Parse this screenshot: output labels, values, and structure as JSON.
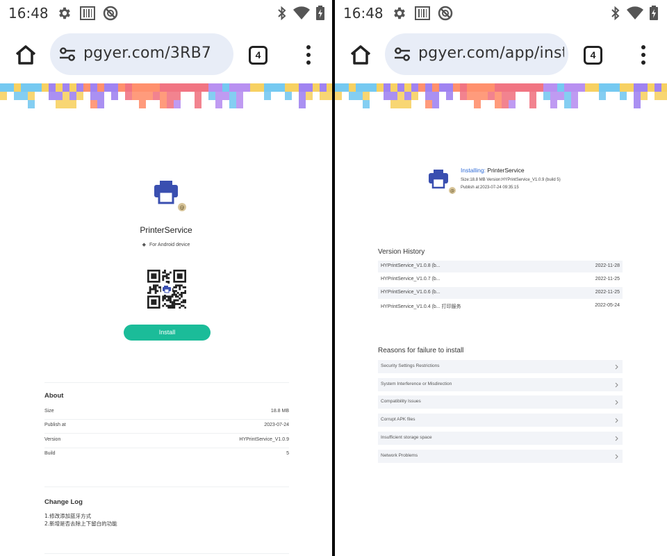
{
  "status_bar": {
    "time": "16:48",
    "icons": [
      "settings-icon",
      "barcode-icon",
      "no-disturb-icon",
      "bluetooth-icon",
      "wifi-icon",
      "battery-icon"
    ]
  },
  "left": {
    "url": "pgyer.com/3RB7",
    "tab_count": "4",
    "app_name": "PrinterService",
    "platform": "For Android device",
    "install_label": "Install",
    "about": {
      "title": "About",
      "rows": [
        {
          "key": "Size",
          "value": "18.8 MB"
        },
        {
          "key": "Publish at",
          "value": "2023-07-24"
        },
        {
          "key": "Version",
          "value": "HYPrintService_V1.0.9"
        },
        {
          "key": "Build",
          "value": "5"
        }
      ]
    },
    "changelog": {
      "title": "Change Log",
      "lines": [
        "1.修改添加蓝牙方式",
        "2.新增是否去除上下留白的功能"
      ]
    }
  },
  "right": {
    "url": "pgyer.com/app/inst",
    "tab_count": "4",
    "installing_label": "Installing:",
    "installing_name": " PrinterService",
    "meta_line1": "Size:18.8 MB Version:HYPrintService_V1.0.9 (build 5)",
    "meta_line2": "Publish at:2023-07-24 09:35:15",
    "version_history": {
      "title": "Version History",
      "rows": [
        {
          "name": "HYPrintService_V1.0.8 (b...",
          "date": "2022-11-28"
        },
        {
          "name": "HYPrintService_V1.0.7 (b...",
          "date": "2022-11-25"
        },
        {
          "name": "HYPrintService_V1.0.6 (b...",
          "date": "2022-11-25"
        },
        {
          "name": "HYPrintService_V1.0.4 (b...   打印服务",
          "date": "2022-05-24"
        }
      ]
    },
    "failure": {
      "title": "Reasons for failure to install",
      "items": [
        "Security Settings Restrictions",
        "System Interference or Misdirection",
        "Compatibility Issues",
        "Corrupt APK files",
        "Insufficient storage space",
        "Network Problems"
      ]
    }
  },
  "colors": {
    "accent_green": "#1bbc99",
    "printer_blue": "#3a4fb0",
    "link_blue": "#2e6bd6",
    "url_bar_bg": "#e8edf7",
    "banner": [
      "#6ec6f0",
      "#f7cf5a",
      "#9b7cf0",
      "#ff8a65",
      "#f06d7b",
      "#b48af0"
    ]
  }
}
